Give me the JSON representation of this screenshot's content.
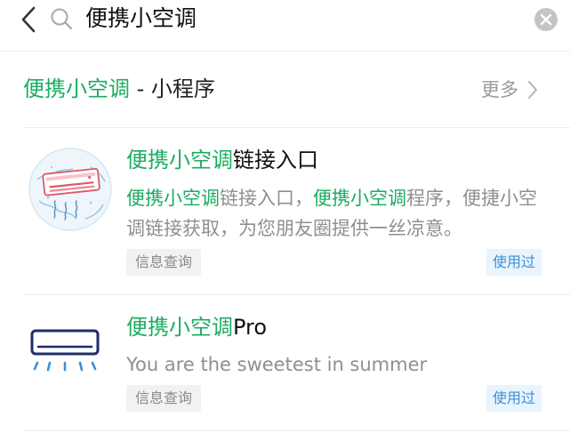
{
  "search": {
    "query": "便携小空调",
    "icons": {
      "back": "back-chevron-icon",
      "search": "search-icon",
      "clear": "clear-icon"
    }
  },
  "section": {
    "title_highlight": "便携小空调",
    "title_rest": " - 小程序",
    "more_label": "更多"
  },
  "results": [
    {
      "title_highlight": "便携小空调",
      "title_rest": "链接入口",
      "desc_parts": [
        "便携小空调",
        "链接入口，",
        "便携小空调",
        "程序，便捷小空调链接获取，为您朋友圈提供一丝凉意。"
      ],
      "tag": "信息查询",
      "badge": "使用过",
      "icon": "air-conditioner-illustration-icon"
    },
    {
      "title_highlight": "便携小空调",
      "title_rest": "Pro",
      "desc": "You are the sweetest in summer",
      "tag": "信息查询",
      "badge": "使用过",
      "icon": "air-conditioner-icon"
    }
  ],
  "colors": {
    "highlight": "#1aad61",
    "badge_text": "#3d8fd8",
    "badge_bg": "#e9f4fd",
    "icon_navy": "#1b2d6b",
    "icon_blue": "#3a8fd9"
  }
}
